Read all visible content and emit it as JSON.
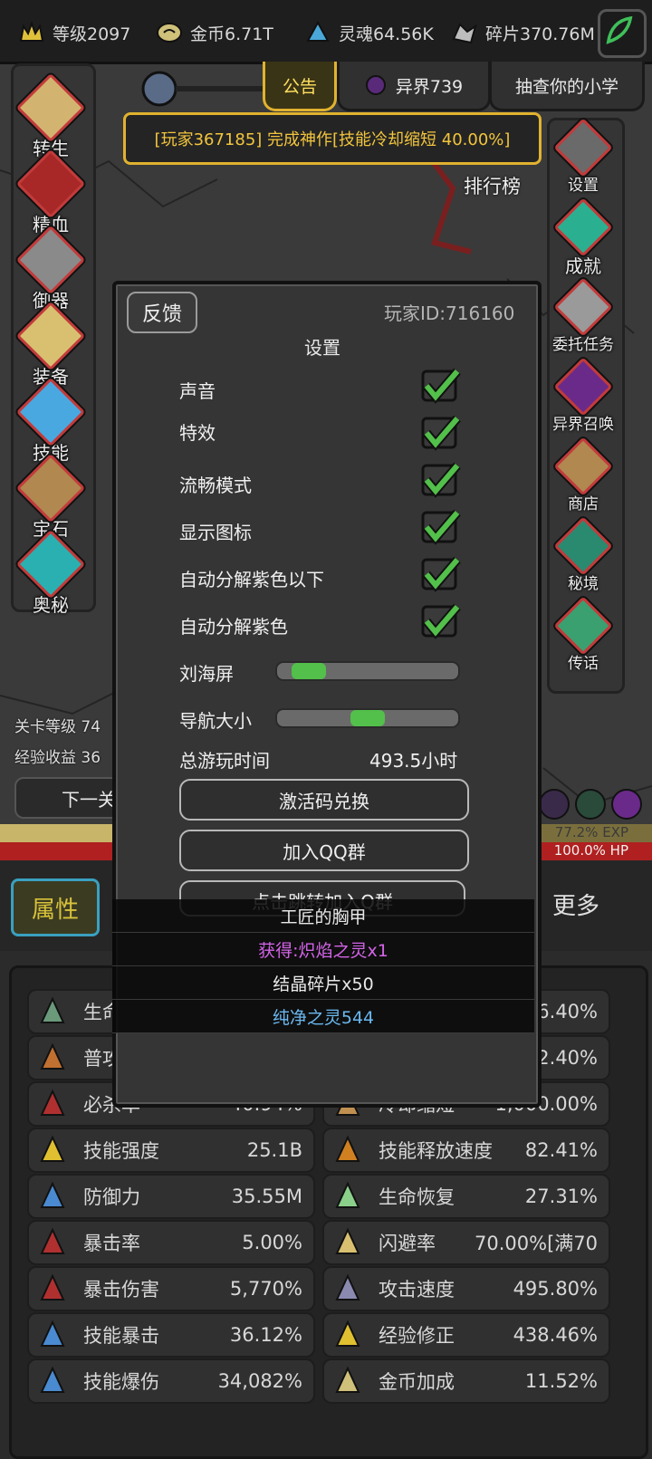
{
  "resources": [
    {
      "label": "等级2097",
      "icon": "crown-icon"
    },
    {
      "label": "金币6.71T",
      "icon": "coin-icon"
    },
    {
      "label": "灵魂64.56K",
      "icon": "soul-icon"
    },
    {
      "label": "碎片370.76M",
      "icon": "shard-icon"
    }
  ],
  "tabs": {
    "notice": "公告",
    "otherworld": "异界739",
    "check": "抽查你的小学"
  },
  "announcement": "[玩家367185] 完成神作[技能冷却缩短 40.00%]",
  "left_menu": [
    "转生",
    "精血",
    "御器",
    "装备",
    "技能",
    "宝石",
    "奥秘"
  ],
  "right_menu": [
    "设置",
    "成就",
    "委托任务",
    "异界召唤",
    "商店",
    "秘境",
    "传话"
  ],
  "leaderboard": "排行榜",
  "stage": {
    "level_label": "关卡等级 74",
    "exp_label": "经验收益 36",
    "next_button": "下一关"
  },
  "bars": {
    "exp_text": "77.2% EXP",
    "hp_text": "100.0% HP",
    "exp_percent": 77.2,
    "hp_percent": 100.0
  },
  "attributes_tab": "属性",
  "more": "更多",
  "settings_dialog": {
    "feedback": "反馈",
    "player_id": "玩家ID:716160",
    "title": "设置",
    "toggles": [
      {
        "label": "声音",
        "checked": true
      },
      {
        "label": "特效",
        "checked": true
      },
      {
        "label": "流畅模式",
        "checked": true
      },
      {
        "label": "显示图标",
        "checked": true
      },
      {
        "label": "自动分解紫色以下",
        "checked": true
      },
      {
        "label": "自动分解紫色",
        "checked": true
      }
    ],
    "notch_label": "刘海屏",
    "notch_value": 0.1,
    "nav_label": "导航大小",
    "nav_value": 0.5,
    "playtime_label": "总游玩时间",
    "playtime_value": "493.5小时",
    "redeem_button": "激活码兑换",
    "qq_button": "加入QQ群",
    "jump_button": "点击跳转加入Q群"
  },
  "loot": [
    {
      "text": "工匠的胸甲",
      "color": "#f0f0f0"
    },
    {
      "text": "获得:炽焰之灵x1",
      "color": "#d464e8"
    },
    {
      "text": "结晶碎片x50",
      "color": "#f0f0f0"
    },
    {
      "text": "纯净之灵544",
      "color": "#6ab8f0"
    }
  ],
  "stats_left": [
    {
      "name": "生命",
      "value": ""
    },
    {
      "name": "普攻",
      "value": ""
    },
    {
      "name": "必杀率",
      "value": "40.94%"
    },
    {
      "name": "技能强度",
      "value": "25.1B"
    },
    {
      "name": "防御力",
      "value": "35.55M"
    },
    {
      "name": "暴击率",
      "value": "5.00%"
    },
    {
      "name": "暴击伤害",
      "value": "5,770%"
    },
    {
      "name": "技能暴击",
      "value": "36.12%"
    },
    {
      "name": "技能爆伤",
      "value": "34,082%"
    }
  ],
  "stats_right": [
    {
      "name": "",
      "value": "26.40%"
    },
    {
      "name": "",
      "value": "12.40%"
    },
    {
      "name": "冷却缩短",
      "value": "1,000.00%"
    },
    {
      "name": "技能释放速度",
      "value": "82.41%"
    },
    {
      "name": "生命恢复",
      "value": "27.31%"
    },
    {
      "name": "闪避率",
      "value": "70.00%[满70"
    },
    {
      "name": "攻击速度",
      "value": "495.80%"
    },
    {
      "name": "经验修正",
      "value": "438.46%"
    },
    {
      "name": "金币加成",
      "value": "11.52%"
    }
  ],
  "colors": {
    "accent": "#e0b22f",
    "check": "#52c04a",
    "hp": "#b02020",
    "exp": "#7a6f3c"
  }
}
